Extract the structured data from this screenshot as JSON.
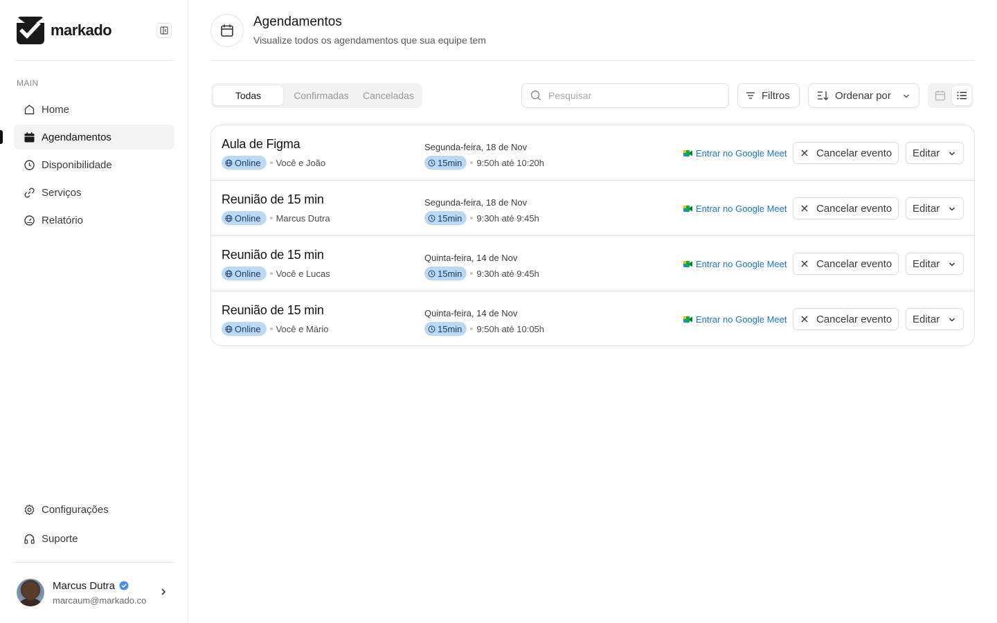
{
  "app": {
    "logo_text": "markado"
  },
  "sidebar": {
    "section_label": "MAIN",
    "items": [
      {
        "label": "Home",
        "icon": "home-icon"
      },
      {
        "label": "Agendamentos",
        "icon": "calendar-icon",
        "active": true
      },
      {
        "label": "Disponibilidade",
        "icon": "clock-icon"
      },
      {
        "label": "Serviços",
        "icon": "link-icon"
      },
      {
        "label": "Relatório",
        "icon": "gauge-icon"
      }
    ],
    "bottom_items": [
      {
        "label": "Configurações",
        "icon": "gear-icon"
      },
      {
        "label": "Suporte",
        "icon": "headphones-icon"
      }
    ],
    "profile": {
      "name": "Marcus Dutra",
      "email": "marcaum@markado.co"
    }
  },
  "header": {
    "title": "Agendamentos",
    "subtitle": "Visualize todos os agendamentos que sua equipe tem"
  },
  "tabs": [
    {
      "label": "Todas",
      "active": true
    },
    {
      "label": "Confirmadas",
      "active": false
    },
    {
      "label": "Canceladas",
      "active": false
    }
  ],
  "toolbar": {
    "search_placeholder": "Pesquisar",
    "filters_label": "Filtros",
    "order_label": "Ordenar por",
    "view_mode": "list"
  },
  "colors": {
    "accent_pill": "#bcd8f7",
    "link": "#1976d2"
  },
  "events": [
    {
      "title": "Aula de Figma",
      "location": "Online",
      "participants": "Você e João",
      "date": "Segunda-feira, 18 de Nov",
      "duration": "15min",
      "time": "9:50h até 10:20h",
      "meet_label": "Entrar no Google Meet",
      "cancel_label": "Cancelar evento",
      "edit_label": "Editar"
    },
    {
      "title": "Reunião de 15 min",
      "location": "Online",
      "participants": "Marcus Dutra",
      "date": "Segunda-feira, 18 de Nov",
      "duration": "15min",
      "time": "9:30h até 9:45h",
      "meet_label": "Entrar no Google Meet",
      "cancel_label": "Cancelar evento",
      "edit_label": "Editar"
    },
    {
      "title": "Reunião de 15 min",
      "location": "Online",
      "participants": "Você e Lucas",
      "date": "Quinta-feira, 14 de Nov",
      "duration": "15min",
      "time": "9:30h até 9:45h",
      "meet_label": "Entrar no Google Meet",
      "cancel_label": "Cancelar evento",
      "edit_label": "Editar"
    },
    {
      "title": "Reunião de 15 min",
      "location": "Online",
      "participants": "Você e Mário",
      "date": "Quinta-feira, 14 de Nov",
      "duration": "15min",
      "time": "9:50h até 10:05h",
      "meet_label": "Entrar no Google Meet",
      "cancel_label": "Cancelar evento",
      "edit_label": "Editar"
    }
  ]
}
